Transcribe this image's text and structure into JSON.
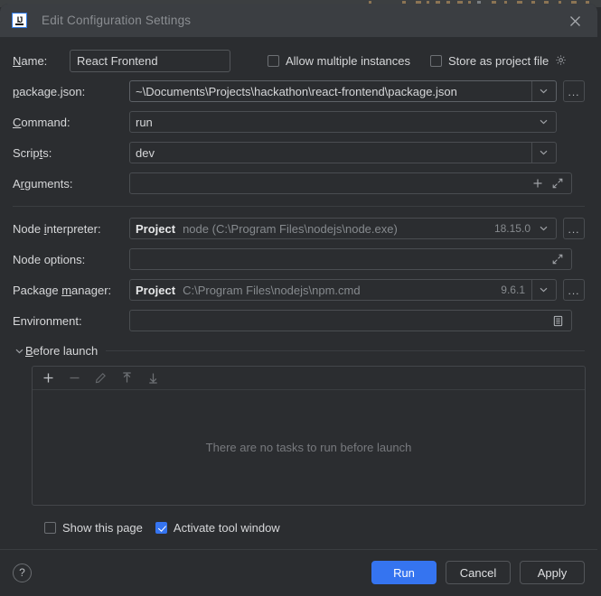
{
  "window": {
    "title": "Edit Configuration Settings",
    "app_icon": "intellij-idea-icon",
    "close_icon": "close-icon"
  },
  "colors": {
    "dialog_bg": "#2b2d30",
    "titlebar_bg": "#3b3e42",
    "accent": "#3574f0",
    "field_border": "#4a4d51",
    "text": "#d6d7d9",
    "text_dim": "#868a8e"
  },
  "form": {
    "name": {
      "label": "Name:",
      "label_mnemonic": "N",
      "value": "React Frontend",
      "placeholder": "Name"
    },
    "allow_multiple_instances": {
      "label": "Allow multiple instances",
      "checked": false
    },
    "store_as_project_file": {
      "label": "Store as project file",
      "checked": false,
      "gear_icon": "gear-icon"
    },
    "package_json": {
      "label": "package.json:",
      "label_mnemonic": "p",
      "value": "~\\Documents\\Projects\\hackathon\\react-frontend\\package.json",
      "browse_label": "...",
      "chevron": "chevron-down-icon"
    },
    "command": {
      "label": "Command:",
      "label_mnemonic": "C",
      "value": "run",
      "chevron": "chevron-down-icon"
    },
    "scripts": {
      "label": "Scripts:",
      "label_mnemonic": "t",
      "value": "dev",
      "chevron": "chevron-down-icon"
    },
    "arguments": {
      "label": "Arguments:",
      "label_mnemonic": "r",
      "value": "",
      "placeholder": "",
      "add_icon": "plus-icon",
      "expand_icon": "expand-icon"
    },
    "node_interpreter": {
      "label": "Node interpreter:",
      "label_mnemonic": "i",
      "scope": "Project",
      "path": "node (C:\\Program Files\\nodejs\\node.exe)",
      "version": "18.15.0",
      "browse_label": "...",
      "chevron": "chevron-down-icon"
    },
    "node_options": {
      "label": "Node options:",
      "value": "",
      "expand_icon": "expand-icon"
    },
    "package_manager": {
      "label": "Package manager:",
      "label_mnemonic": "m",
      "scope": "Project",
      "path": "C:\\Program Files\\nodejs\\npm.cmd",
      "version": "9.6.1",
      "browse_label": "...",
      "chevron": "chevron-down-icon"
    },
    "environment": {
      "label": "Environment:",
      "value": "",
      "editor_icon": "environment-variables-icon"
    }
  },
  "before_launch": {
    "title": "Before launch",
    "title_mnemonic": "B",
    "expanded": true,
    "collapse_icon": "chevron-down-icon",
    "toolbar": [
      {
        "name": "add-task-button",
        "icon": "plus-icon",
        "enabled": true
      },
      {
        "name": "remove-task-button",
        "icon": "minus-icon",
        "enabled": false
      },
      {
        "name": "edit-task-button",
        "icon": "pencil-icon",
        "enabled": false
      },
      {
        "name": "move-up-button",
        "icon": "arrow-up-icon",
        "enabled": false
      },
      {
        "name": "move-down-button",
        "icon": "arrow-down-icon",
        "enabled": false
      }
    ],
    "empty_text": "There are no tasks to run before launch"
  },
  "options": {
    "show_this_page": {
      "label": "Show this page",
      "checked": false
    },
    "activate_tool_window": {
      "label": "Activate tool window",
      "checked": true
    }
  },
  "footer": {
    "help_label": "?",
    "run_label": "Run",
    "cancel_label": "Cancel",
    "apply_label": "Apply"
  }
}
